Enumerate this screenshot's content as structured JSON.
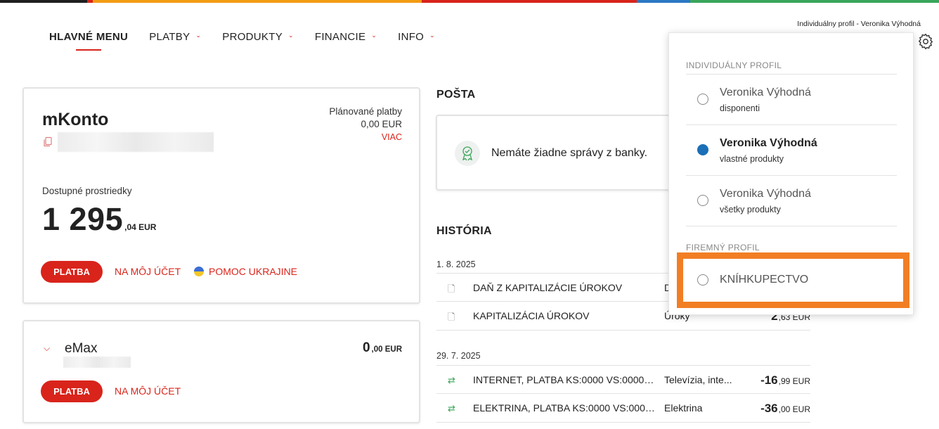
{
  "topbar": {
    "colors": [
      "#1f1f1f",
      "#d9241b",
      "#f39c12",
      "#d9241b",
      "#2b78c5",
      "#3aa55a"
    ]
  },
  "nav": {
    "main": "HLAVNÉ MENU",
    "payments": "PLATBY",
    "products": "PRODUKTY",
    "finance": "FINANCIE",
    "info": "INFO"
  },
  "header": {
    "profile_label": "Individuálny profil - Veronika Výhodná",
    "settings_icon": "gear-icon"
  },
  "mkonto": {
    "name": "mKonto",
    "planned_label": "Plánované platby",
    "planned_amount": "0,00 EUR",
    "more": "VIAC",
    "available_label": "Dostupné prostriedky",
    "amount_main": "1 295",
    "amount_decimal": ",04 EUR",
    "pay_button": "PLATBA",
    "own_account": "NA MÔJ ÚČET",
    "ukraine_help": "POMOC UKRAJINE"
  },
  "emax": {
    "name": "eMax",
    "amount_main": "0",
    "amount_decimal": ",00 EUR",
    "pay_button": "PLATBA",
    "own_account": "NA MÔJ ÚČET"
  },
  "mail": {
    "title": "POŠTA",
    "empty_text": "Nemáte žiadne správy z banky."
  },
  "history": {
    "title": "HISTÓRIA",
    "groups": [
      {
        "date": "1. 8. 2025",
        "rows": [
          {
            "icon": "document-icon",
            "name": "DAŇ Z KAPITALIZÁCIE ÚROKOV",
            "category": "D",
            "amount_main": "",
            "amount_decimal": ""
          },
          {
            "icon": "document-icon",
            "name": "KAPITALIZÁCIA ÚROKOV",
            "category": "Úroky",
            "amount_main": "2",
            "amount_decimal": ",63 EUR"
          }
        ]
      },
      {
        "date": "29. 7. 2025",
        "rows": [
          {
            "icon": "transfer-icon",
            "name": "INTERNET, PLATBA KS:0000 VS:000000...",
            "category": "Televízia, inte...",
            "amount_main": "-16",
            "amount_decimal": ",99 EUR"
          },
          {
            "icon": "transfer-icon",
            "name": "ELEKTRINA, PLATBA KS:0000 VS:00000...",
            "category": "Elektrina",
            "amount_main": "-36",
            "amount_decimal": ",00 EUR"
          }
        ]
      }
    ]
  },
  "dropdown": {
    "individual_header": "INDIVIDUÁLNY PROFIL",
    "items": [
      {
        "name": "Veronika Výhodná",
        "sub": "disponenti",
        "selected": false
      },
      {
        "name": "Veronika Výhodná",
        "sub": "vlastné produkty",
        "selected": true
      },
      {
        "name": "Veronika Výhodná",
        "sub": "všetky produkty",
        "selected": false
      }
    ],
    "company_header": "FIREMNÝ PROFIL",
    "company_item": "KNÍHKUPECTVO",
    "highlight_color": "#f27e24"
  }
}
